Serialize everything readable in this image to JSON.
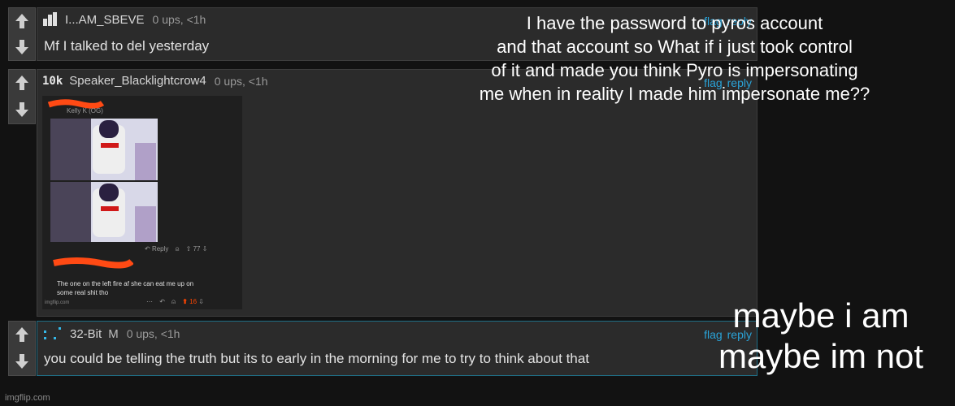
{
  "comments": [
    {
      "username": "I...AM_SBEVE",
      "score": "0 ups, <1h",
      "text": "Mf I talked to del yesterday",
      "badge": "user-icon",
      "flag_label": "flag",
      "reply_label": "reply"
    },
    {
      "username": "Speaker_Blacklightcrow4",
      "score": "0 ups, <1h",
      "badge_text": "10k",
      "flag_label": "flag",
      "reply_label": "reply",
      "embedded_image": {
        "header_name": "Kelly K (OG)",
        "reply_label_1": "Reply",
        "count_1": "77",
        "comment_text_1": "The one on the left fire af she can eat me up on",
        "comment_text_2": "some real shit tho",
        "count_2": "16",
        "watermark": "imgflip.com"
      }
    },
    {
      "username": "32-Bit",
      "mod_label": "M",
      "score": "0 ups, <1h",
      "text": "you could be telling the truth but its to early in the morning for me to try to think about that",
      "flag_label": "flag",
      "reply_label": "reply"
    }
  ],
  "overlay_top": {
    "line1": "I have the password to pyros account",
    "line2": "and that account so What if i just took control",
    "line3": "of it and made you think Pyro is impersonating",
    "line4": "me when in reality I made him impersonate me??"
  },
  "overlay_bottom": {
    "line1": "maybe i am",
    "line2": "maybe im not"
  },
  "watermark": "imgflip.com",
  "colors": {
    "background": "#121212",
    "comment_bg": "#2b2b2b",
    "link": "#2aa3d8",
    "redaction": "#ff4a14",
    "upvote_active": "#ff4500"
  }
}
